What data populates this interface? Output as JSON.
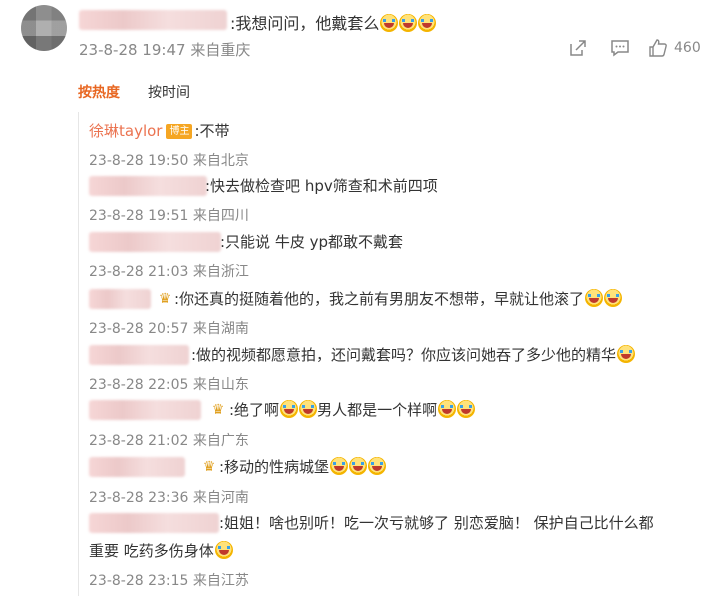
{
  "comment": {
    "text": ":我想问问，他戴套么",
    "timestamp": "23-8-28 19:47",
    "location": "来自重庆",
    "like_count": "460"
  },
  "sort_tabs": {
    "hot": "按热度",
    "time": "按时间"
  },
  "replies": [
    {
      "author": "徐琳taylor",
      "badge": "博主",
      "text": ":不带",
      "timestamp": "23-8-28 19:50",
      "location": "来自北京"
    },
    {
      "text": ":快去做检查吧 hpv筛查和术前四项",
      "timestamp": "23-8-28 19:51",
      "location": "来自四川"
    },
    {
      "text": ":只能说 牛皮 yp都敢不戴套",
      "timestamp": "23-8-28 21:03",
      "location": "来自浙江"
    },
    {
      "text": ":你还真的挺随着他的，我之前有男朋友不想带，早就让他滚了",
      "timestamp": "23-8-28 20:57",
      "location": "来自湖南"
    },
    {
      "text": ":做的视频都愿意拍，还问戴套吗？你应该问她吞了多少他的精华",
      "timestamp": "23-8-28 22:05",
      "location": "来自山东"
    },
    {
      "text_a": ":绝了啊",
      "text_b": "男人都是一个样啊",
      "timestamp": "23-8-28 21:02",
      "location": "来自广东"
    },
    {
      "text": ":移动的性病城堡",
      "timestamp": "23-8-28 23:36",
      "location": "来自河南"
    },
    {
      "text_line1": ":姐姐！啥也别听！吃一次亏就够了 别恋爱脑！ 保护自己比什么都",
      "text_line2": "重要 吃药多伤身体",
      "timestamp": "23-8-28 23:15",
      "location": "来自江苏"
    }
  ]
}
